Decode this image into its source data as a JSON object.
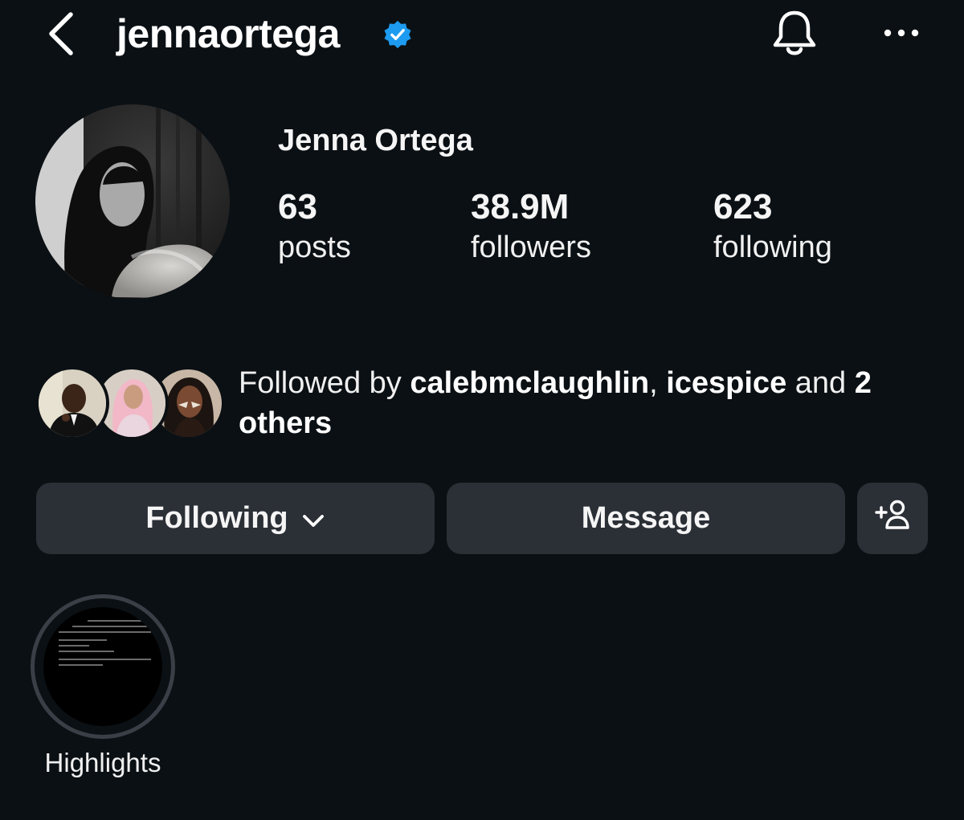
{
  "header": {
    "username": "jennaortega",
    "verified": true,
    "icons": [
      "back-arrow-icon",
      "verified-badge-icon",
      "bell-icon",
      "more-dots-icon"
    ],
    "verified_color": "#1d9bf0"
  },
  "profile": {
    "display_name": "Jenna Ortega",
    "stats": [
      {
        "value": "63",
        "label": "posts"
      },
      {
        "value": "38.9M",
        "label": "followers"
      },
      {
        "value": "623",
        "label": "following"
      }
    ]
  },
  "followed_by": {
    "prefix": "Followed by",
    "user1": "calebmclaughlin",
    "sep": ",",
    "user2": "icespice",
    "and": "and",
    "rest": "2 others"
  },
  "actions": {
    "following_label": "Following",
    "message_label": "Message",
    "add_icon": "add-person-icon"
  },
  "highlights": [
    {
      "label": "Highlights"
    }
  ],
  "colors": {
    "background": "#0b1014",
    "button": "#2b2f36",
    "text": "#f5f5f5"
  }
}
